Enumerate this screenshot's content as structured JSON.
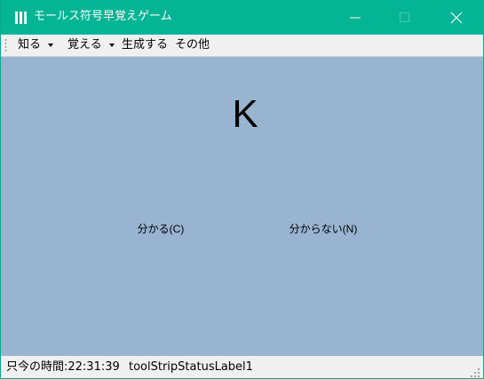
{
  "window": {
    "title": "モールス符号早覚えゲーム",
    "accent_color": "#03b495",
    "client_color": "#98b4d1"
  },
  "menu": {
    "items": [
      {
        "label": "知る",
        "has_dropdown": true
      },
      {
        "label": "覚える",
        "has_dropdown": true
      },
      {
        "label": "生成する",
        "has_dropdown": false
      },
      {
        "label": "その他",
        "has_dropdown": false
      }
    ]
  },
  "main": {
    "letter": "K",
    "know_button": "分かる(C)",
    "dont_know_button": "分からない(N)"
  },
  "status": {
    "time_text": "只今の時間:22:31:39",
    "label1": "toolStripStatusLabel1"
  },
  "icons": {
    "app": "app-icon",
    "minimize": "minimize-icon",
    "maximize": "maximize-icon",
    "close": "close-icon",
    "menu_grip": "grip-icon",
    "resize_grip": "resize-grip-icon"
  }
}
